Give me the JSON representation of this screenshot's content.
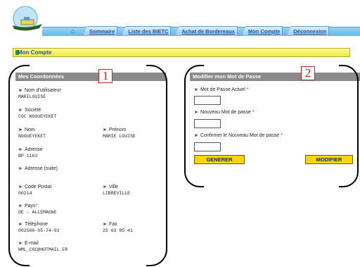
{
  "nav": {
    "tabs": [
      "Sommaire",
      "Liste des BIETC",
      "Achat de Bordereaux",
      "Mon Compte",
      "Déconnexion"
    ]
  },
  "page": {
    "section_title": "Mon Compte"
  },
  "left": {
    "header": "Mes Coordonnées",
    "badge": "1",
    "fields": {
      "username": {
        "label": "Nom d'utilisateur",
        "value": "MARILOUISE"
      },
      "company": {
        "label": "Société",
        "value": "CGC NGOUEYEKET"
      },
      "lastname": {
        "label": "Nom",
        "value": "NGOUEYEKET"
      },
      "firstname": {
        "label": "Prénom",
        "value": "MARIE LOUISE"
      },
      "address": {
        "label": "Adresse",
        "value": "BP 1163"
      },
      "address2": {
        "label": "Adresse (suite)",
        "value": ""
      },
      "postal": {
        "label": "Code Postal",
        "value": "00214"
      },
      "city": {
        "label": "Ville",
        "value": "LIBREVILLE"
      },
      "country": {
        "label": "Pays",
        "value": "DE - ALLEMAGNE"
      },
      "phone": {
        "label": "Téléphone",
        "value": "002506-95-74-93"
      },
      "fax": {
        "label": "Fax",
        "value": "25 63 85 41"
      },
      "email": {
        "label": "E-mail",
        "value": "NML_CGC@HOTMAIL.FR"
      }
    }
  },
  "right": {
    "header": "Modifier mon Mot de Passe",
    "badge": "2",
    "current_label": "Mot de Passe Actuel",
    "new_label": "Nouveau Mot de passe",
    "confirm_label": "Confirmer le Nouveau Mot de passe",
    "generate_button": "GENERER",
    "modify_button": "MODIFIER"
  },
  "colors": {
    "accent": "#1e4f9b",
    "required": "#d62020",
    "button": "#f7d700"
  }
}
